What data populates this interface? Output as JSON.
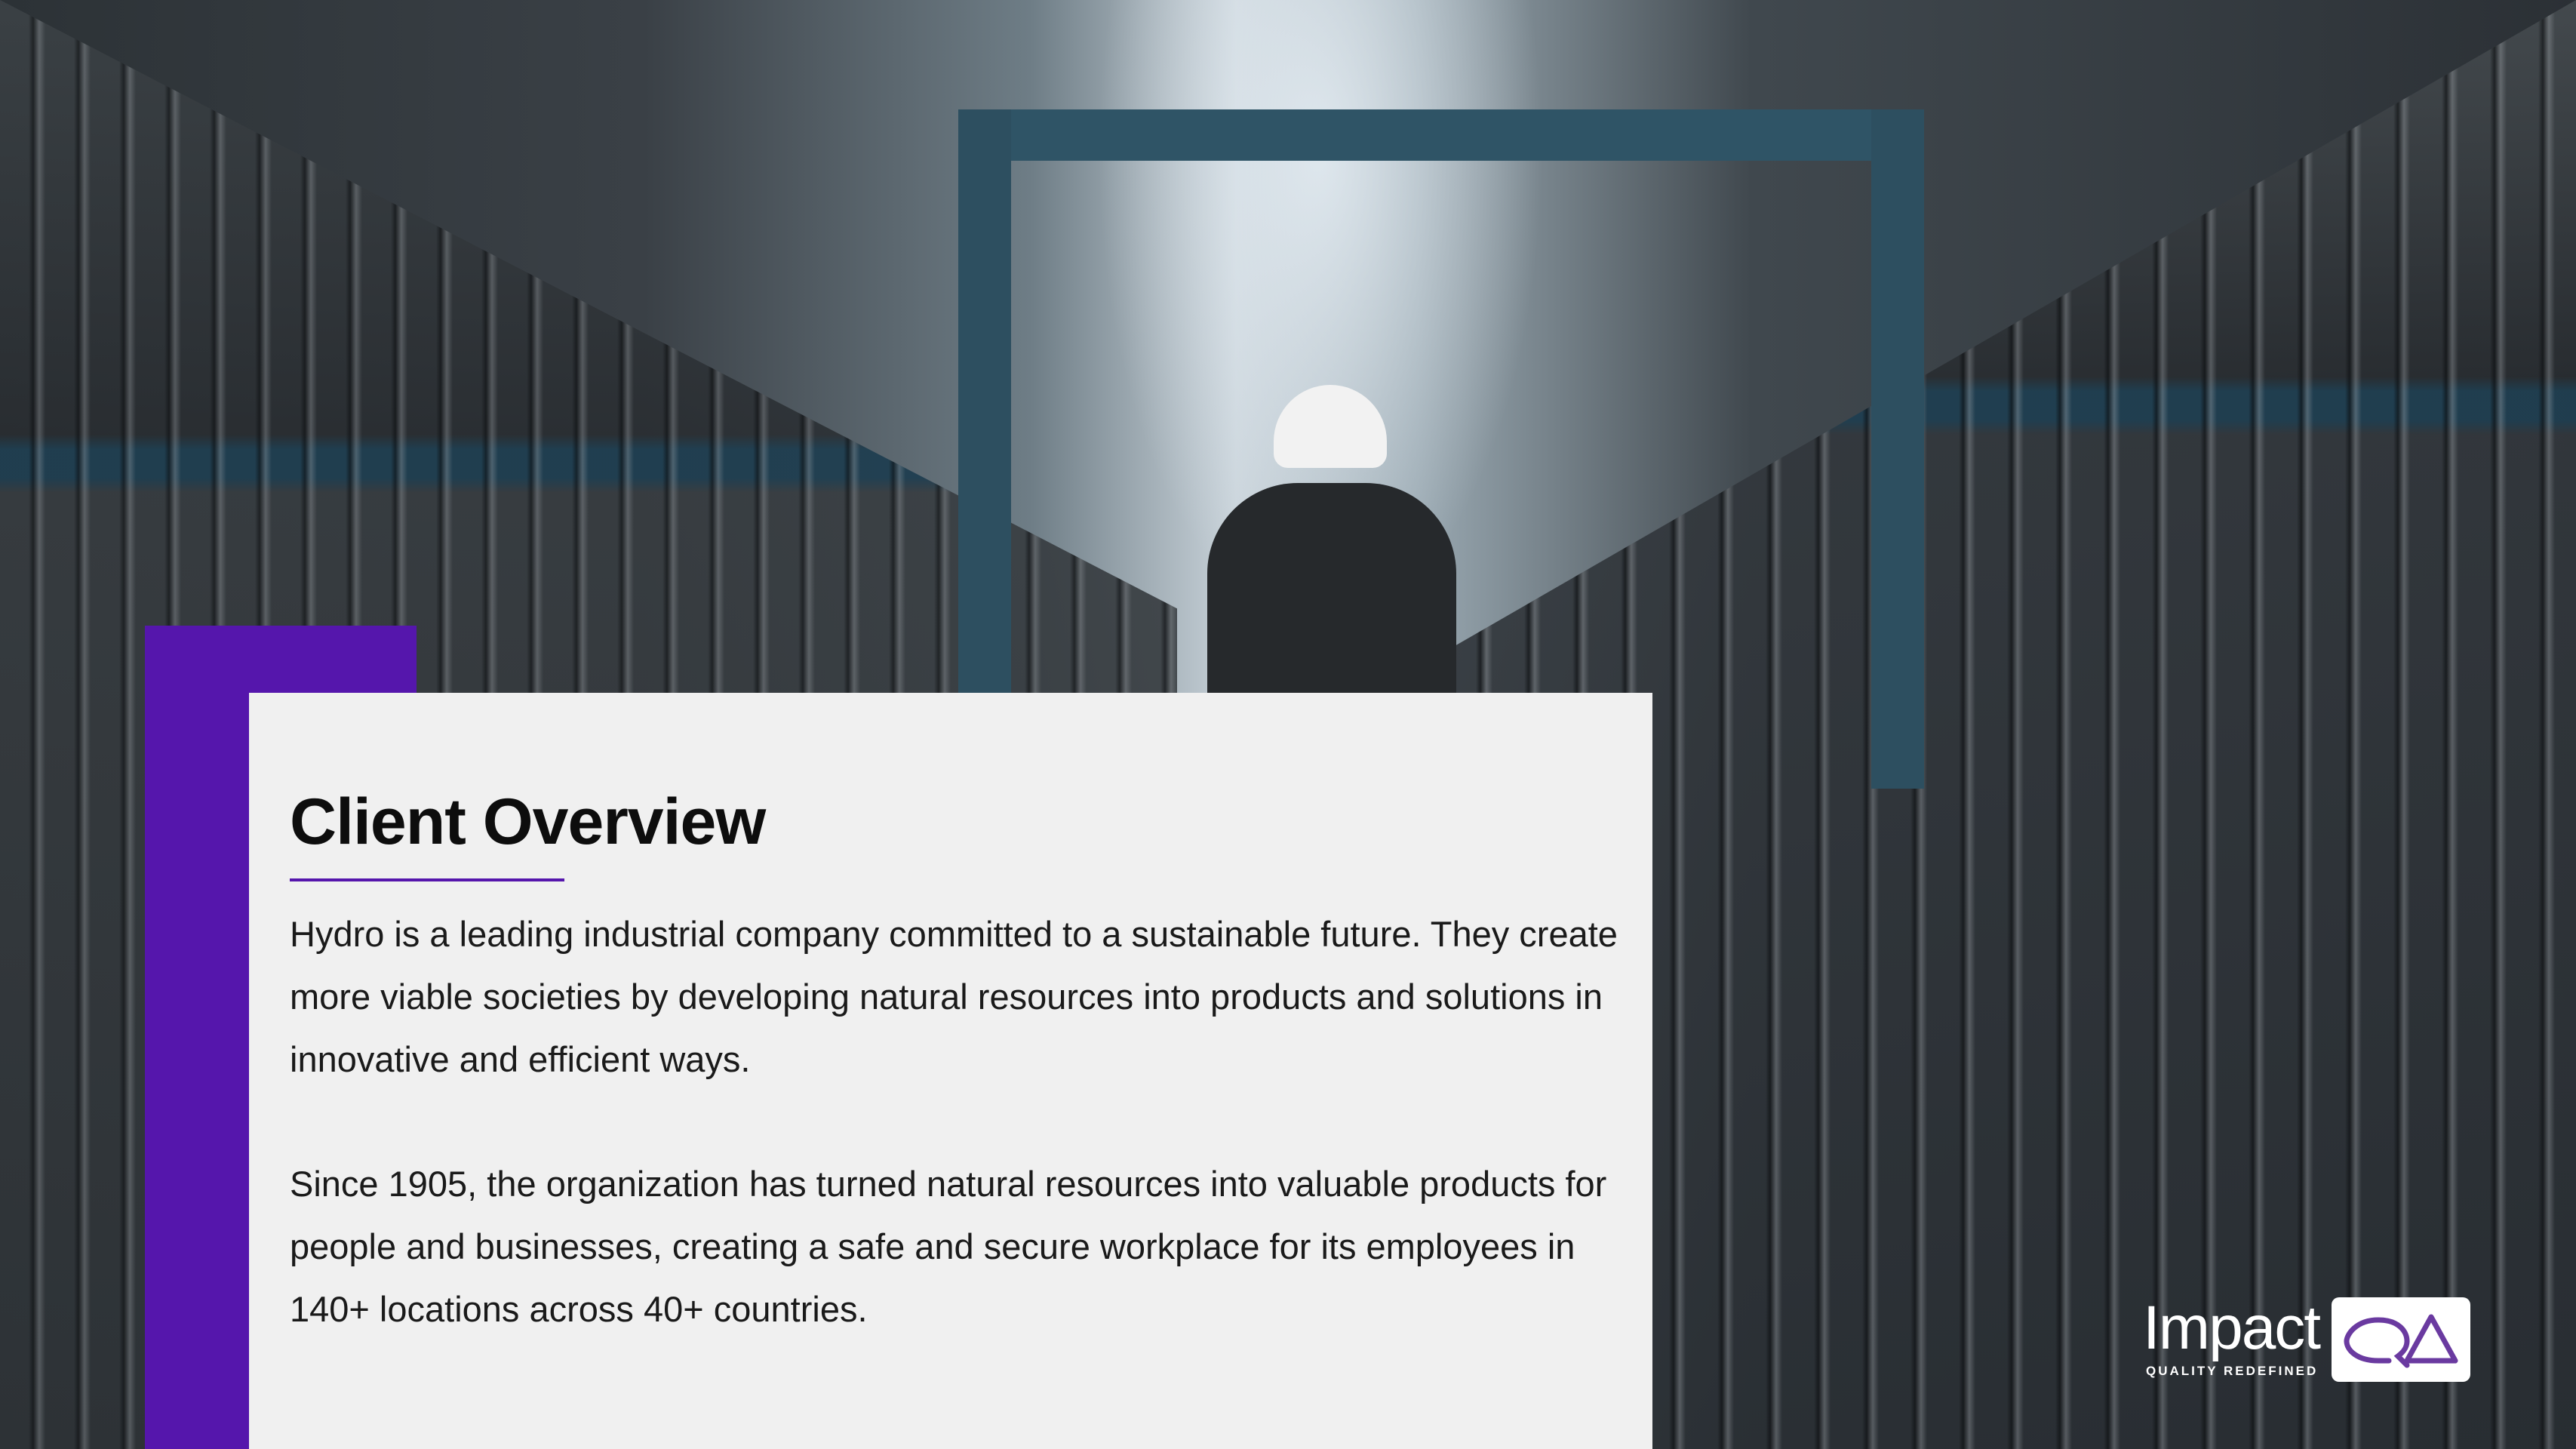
{
  "slide": {
    "title": "Client Overview",
    "paragraphs": [
      "Hydro is a leading industrial company committed to a sustainable future. They create more viable societies by developing natural resources into products and solutions in innovative and efficient ways.",
      "Since 1905, the organization has turned natural resources into valuable products for people and businesses, creating a safe and secure workplace for its employees in 140+ locations across 40+ countries."
    ]
  },
  "logo": {
    "wordmark": "Impact",
    "tagline": "QUALITY REDEFINED",
    "badge_letters": "QA",
    "badge_icon": "qa-logo-icon"
  },
  "colors": {
    "accent": "#5516ac",
    "card_background": "#f0f0f0",
    "title": "#0d0d0d",
    "body_text": "#1a1a1a"
  },
  "background_image": {
    "icon": "warehouse-photo"
  }
}
